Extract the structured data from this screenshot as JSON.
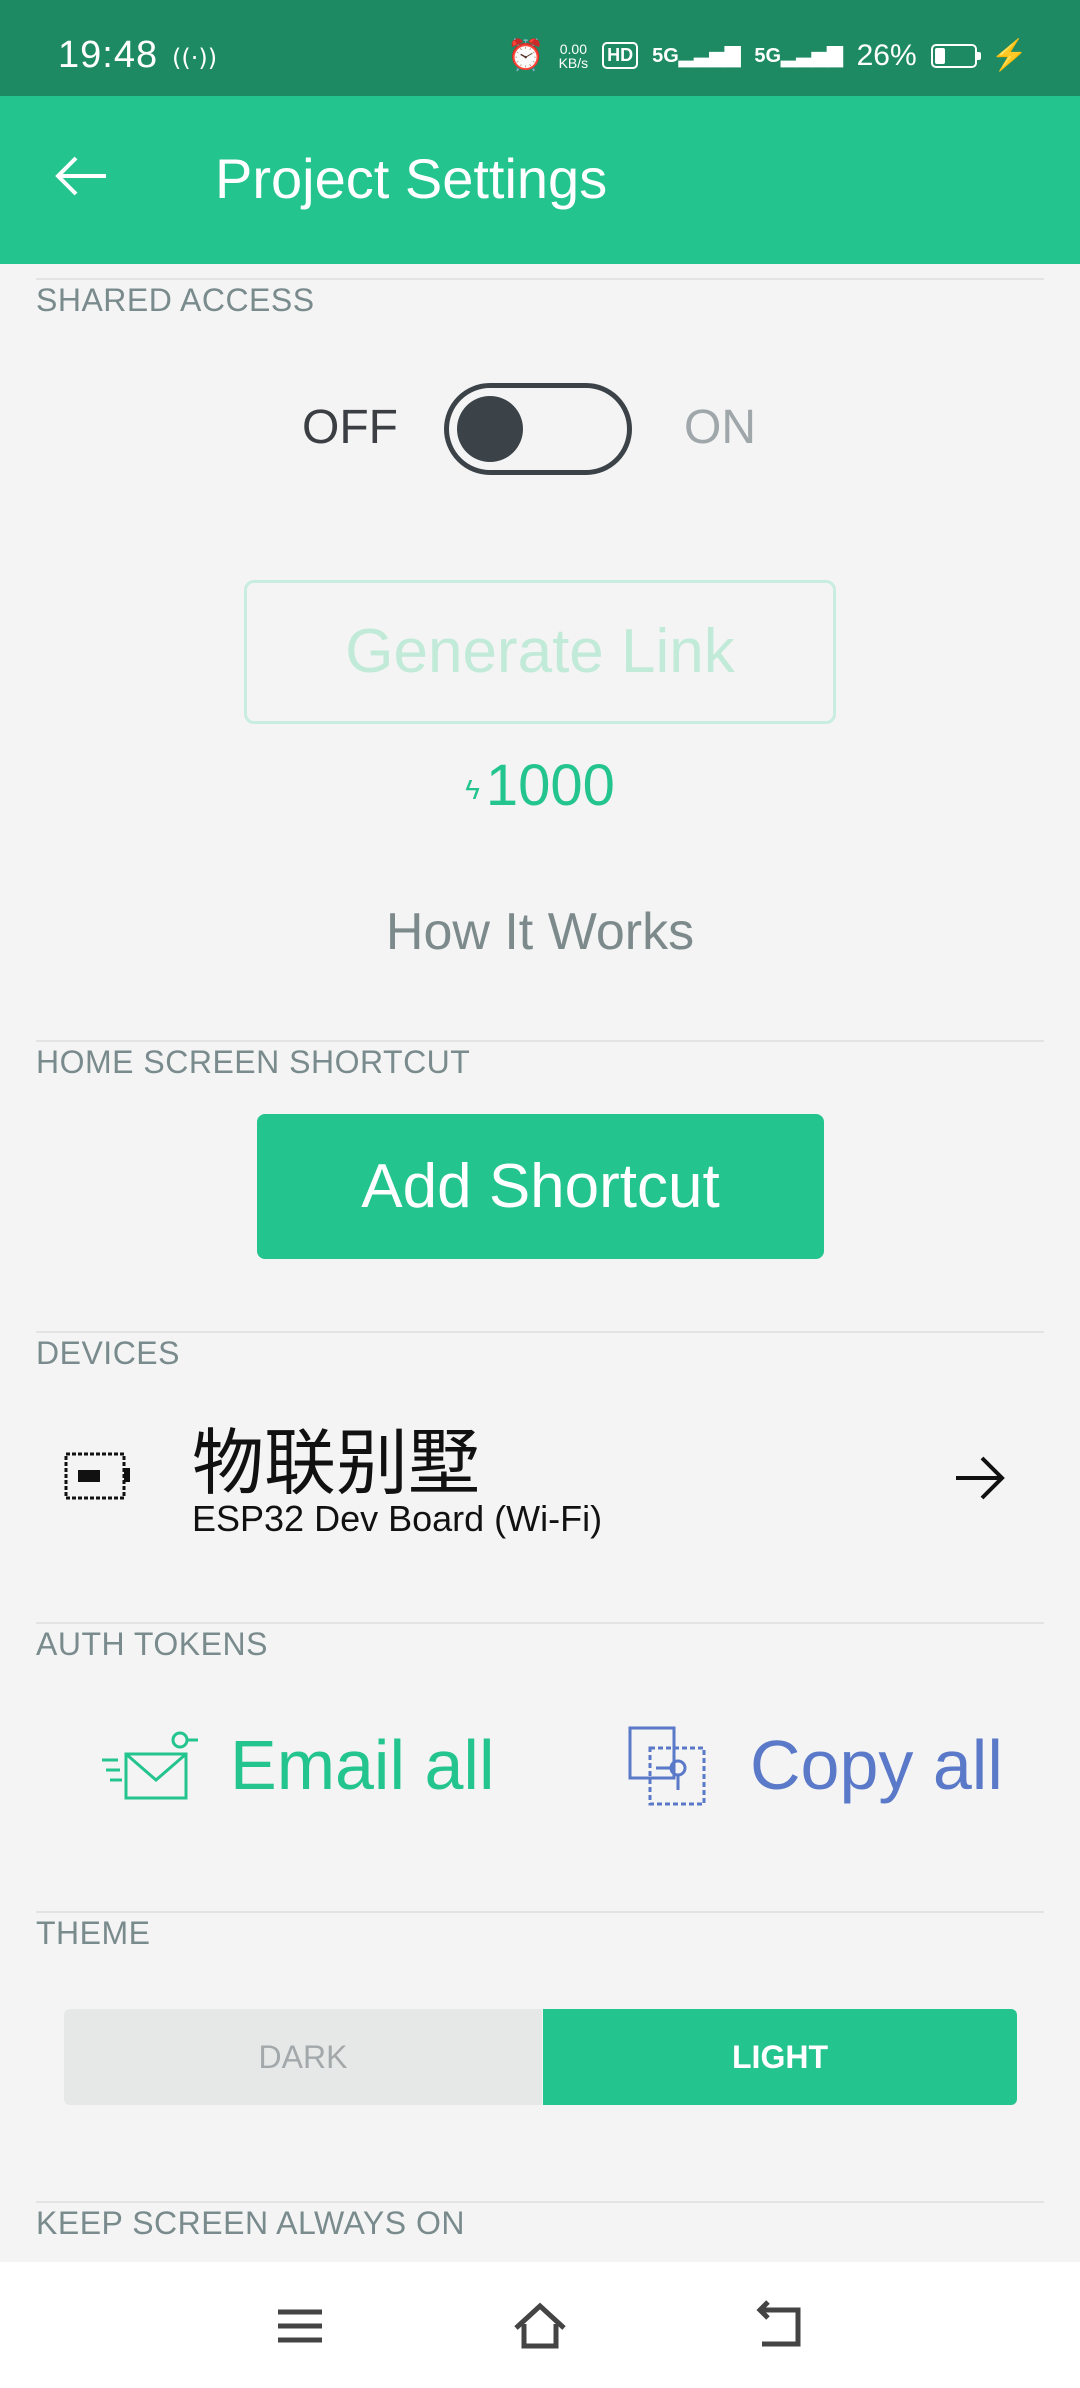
{
  "status_bar": {
    "time": "19:48",
    "net_speed_value": "0.00",
    "net_speed_unit": "KB/s",
    "hd_label": "HD",
    "signal1": "5G",
    "signal2": "5G",
    "battery": "26%",
    "battery_level": 0.26
  },
  "app_bar": {
    "title": "Project Settings"
  },
  "shared_access": {
    "label": "SHARED ACCESS",
    "off_label": "OFF",
    "on_label": "ON",
    "state": "off",
    "generate_link_label": "Generate Link",
    "energy_cost": "1000",
    "how_it_works_label": "How It Works"
  },
  "home_screen_shortcut": {
    "label": "HOME SCREEN SHORTCUT",
    "button_label": "Add Shortcut"
  },
  "devices": {
    "label": "DEVICES",
    "items": [
      {
        "name": "物联别墅",
        "type": "ESP32 Dev Board (Wi-Fi)"
      }
    ]
  },
  "auth_tokens": {
    "label": "AUTH TOKENS",
    "email_label": "Email all",
    "copy_label": "Copy all"
  },
  "theme": {
    "label": "THEME",
    "dark_label": "DARK",
    "light_label": "LIGHT",
    "selected": "LIGHT"
  },
  "keep_screen_on": {
    "label": "KEEP SCREEN ALWAYS ON"
  },
  "colors": {
    "accent": "#23c48e",
    "status_bar": "#1e8a64",
    "copy_blue": "#5a79c8"
  }
}
